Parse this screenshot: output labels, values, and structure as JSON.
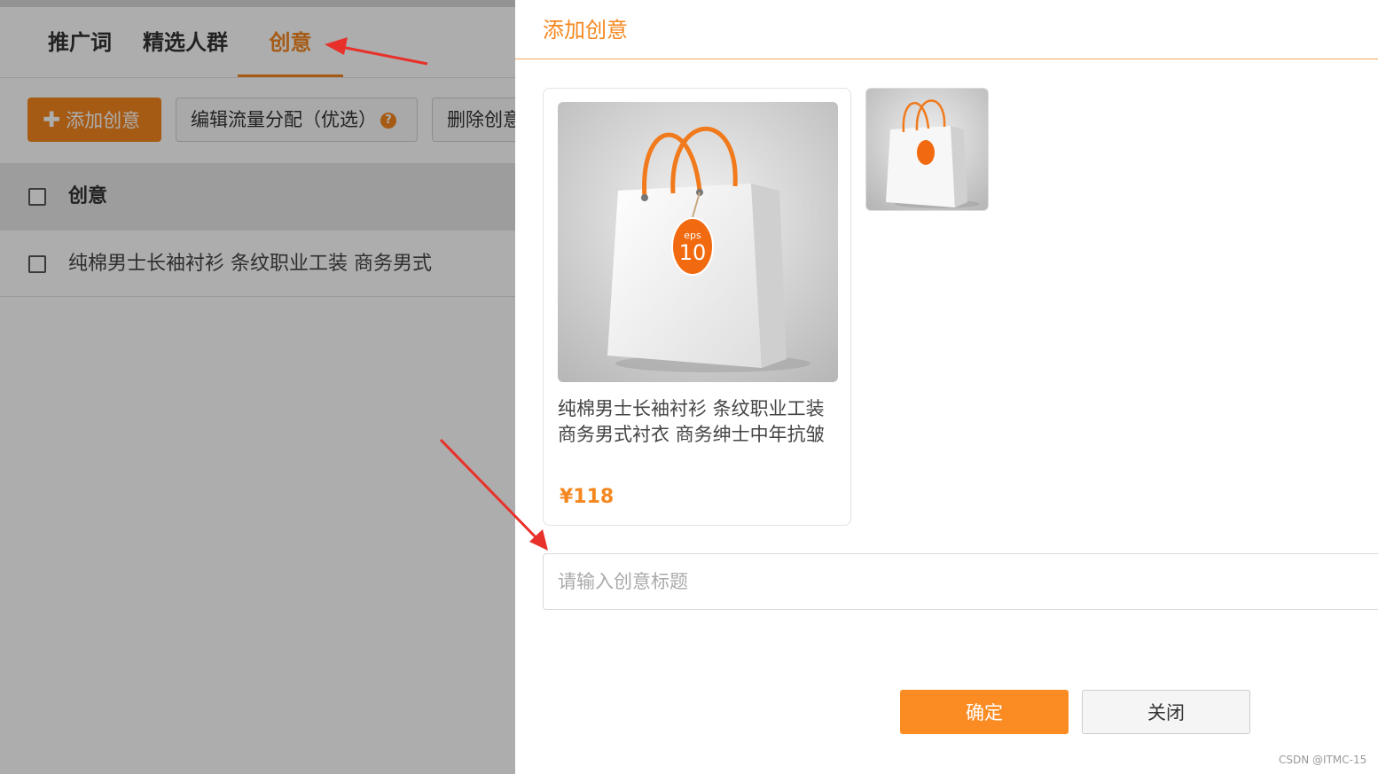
{
  "tabs": [
    {
      "label": "推广词"
    },
    {
      "label": "精选人群"
    },
    {
      "label": "创意",
      "active": true
    }
  ],
  "toolbar": {
    "add_label": "添加创意",
    "traffic_label": "编辑流量分配（优选）",
    "delete_label": "删除创意"
  },
  "table": {
    "header": "创意",
    "rows": [
      {
        "title": "纯棉男士长袖衬衫 条纹职业工装 商务男式"
      }
    ]
  },
  "modal": {
    "title": "添加创意",
    "product": {
      "title": "纯棉男士长袖衬衫 条纹职业工装 商务男式衬衣 商务绅士中年抗皱",
      "price": "¥118",
      "tag_small": "eps",
      "tag_big": "10"
    },
    "input_placeholder": "请输入创意标题",
    "confirm_label": "确定",
    "close_label": "关闭"
  },
  "watermark": "CSDN @ITMC-15",
  "colors": {
    "accent": "#f5871f",
    "annotation_arrow": "#e8312a"
  }
}
